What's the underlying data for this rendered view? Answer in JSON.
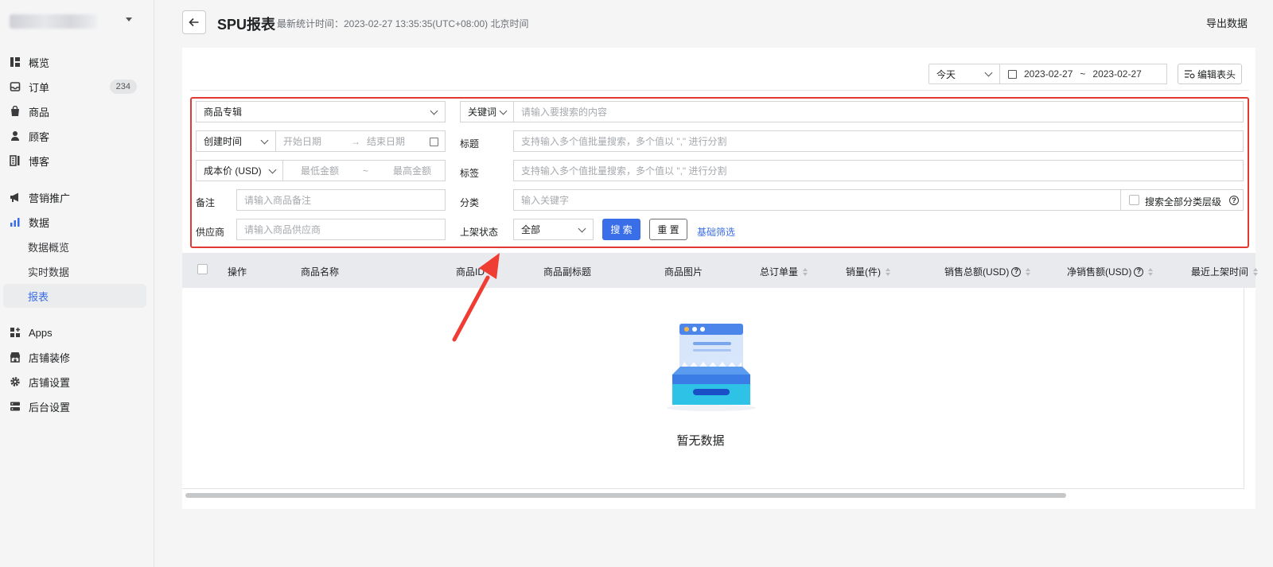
{
  "sidebar": {
    "nav": [
      {
        "label": "概览",
        "icon": "overview-icon"
      },
      {
        "label": "订单",
        "icon": "inbox-icon",
        "badge": "234"
      },
      {
        "label": "商品",
        "icon": "bag-icon"
      },
      {
        "label": "顾客",
        "icon": "person-icon"
      },
      {
        "label": "博客",
        "icon": "blog-icon"
      },
      {
        "label": "营销推广",
        "icon": "megaphone-icon"
      },
      {
        "label": "数据",
        "icon": "bar-chart-icon"
      },
      {
        "label": "Apps",
        "icon": "apps-icon"
      },
      {
        "label": "店铺装修",
        "icon": "store-icon"
      },
      {
        "label": "店铺设置",
        "icon": "gear-icon"
      },
      {
        "label": "后台设置",
        "icon": "server-icon"
      }
    ],
    "sub": [
      {
        "label": "数据概览"
      },
      {
        "label": "实时数据"
      },
      {
        "label": "报表",
        "active": true
      }
    ]
  },
  "header": {
    "title": "SPU报表",
    "stat_time": "最新统计时间：2023-02-27 13:35:35(UTC+08:00) 北京时间",
    "export_label": "导出数据"
  },
  "toolbar": {
    "period": "今天",
    "date_from": "2023-02-27",
    "date_sep": "~",
    "date_to": "2023-02-27",
    "edit_columns": "编辑表头"
  },
  "filters": {
    "collection": "商品专辑",
    "keyword_type": "关键词",
    "keyword_placeholder": "请输入要搜索的内容",
    "time_type": "创建时间",
    "start_date_ph": "开始日期",
    "arrow": "→",
    "end_date_ph": "结束日期",
    "title_label": "标题",
    "title_ph": "支持输入多个值批量搜索，多个值以 \",\" 进行分割",
    "price_type": "成本价 (USD)",
    "min_price_ph": "最低金额",
    "price_sep": "~",
    "max_price_ph": "最高金额",
    "tag_label": "标签",
    "tag_ph": "支持输入多个值批量搜索，多个值以 \",\" 进行分割",
    "note_label": "备注",
    "note_ph": "请输入商品备注",
    "category_label": "分类",
    "category_ph": "输入关键字",
    "search_all_levels": "搜索全部分类层级",
    "supplier_label": "供应商",
    "supplier_ph": "请输入商品供应商",
    "status_label": "上架状态",
    "status_value": "全部",
    "search_btn": "搜 索",
    "reset_btn": "重 置",
    "basic_filter": "基础筛选"
  },
  "table": {
    "columns": [
      "操作",
      "商品名称",
      "商品ID",
      "商品副标题",
      "商品图片",
      "总订单量",
      "销量(件)",
      "销售总额(USD)",
      "净销售额(USD)",
      "最近上架时间"
    ],
    "empty_text": "暂无数据"
  },
  "colors": {
    "accent": "#3a6ee8",
    "highlight_border": "#e03a33",
    "annotation_arrow": "#ef3d33"
  }
}
